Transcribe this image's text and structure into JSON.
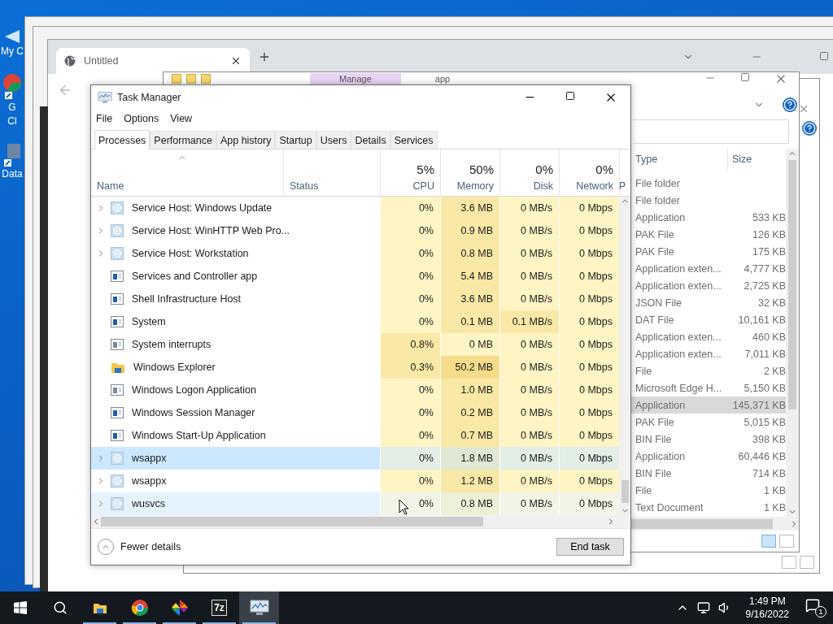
{
  "desktop_icons": [
    {
      "kind": "computer",
      "lines": [
        "My C"
      ]
    },
    {
      "kind": "chrome",
      "lines": [
        "G",
        "Cl"
      ]
    },
    {
      "kind": "drive",
      "lines": [
        "Data"
      ]
    }
  ],
  "browser": {
    "tab": "Untitled"
  },
  "explorer": {
    "ribbon_tabs": [
      {
        "label": "Manage",
        "highlighted": true
      },
      {
        "label": "app",
        "highlighted": false
      }
    ],
    "columns": [
      "Type",
      "Size"
    ],
    "rows": [
      {
        "type": "File folder",
        "size": "",
        "selected": false
      },
      {
        "type": "File folder",
        "size": "",
        "selected": false
      },
      {
        "type": "Application",
        "size": "533 KB",
        "selected": false
      },
      {
        "type": "PAK File",
        "size": "126 KB",
        "selected": false
      },
      {
        "type": "PAK File",
        "size": "175 KB",
        "selected": false
      },
      {
        "type": "Application exten...",
        "size": "4,777 KB",
        "selected": false
      },
      {
        "type": "Application exten...",
        "size": "2,725 KB",
        "selected": false
      },
      {
        "type": "JSON File",
        "size": "32 KB",
        "selected": false
      },
      {
        "type": "DAT File",
        "size": "10,161 KB",
        "selected": false
      },
      {
        "type": "Application exten...",
        "size": "460 KB",
        "selected": false
      },
      {
        "type": "Application exten...",
        "size": "7,011 KB",
        "selected": false
      },
      {
        "type": "File",
        "size": "2 KB",
        "selected": false
      },
      {
        "type": "Microsoft Edge H...",
        "size": "5,150 KB",
        "selected": false
      },
      {
        "type": "Application",
        "size": "145,371 KB",
        "selected": true
      },
      {
        "type": "PAK File",
        "size": "5,015 KB",
        "selected": false
      },
      {
        "type": "BIN File",
        "size": "398 KB",
        "selected": false
      },
      {
        "type": "Application",
        "size": "60,446 KB",
        "selected": false
      },
      {
        "type": "BIN File",
        "size": "714 KB",
        "selected": false
      },
      {
        "type": "File",
        "size": "1 KB",
        "selected": false
      },
      {
        "type": "Text Document",
        "size": "1 KB",
        "selected": false
      }
    ]
  },
  "task_manager": {
    "title": "Task Manager",
    "menu": [
      "File",
      "Options",
      "View"
    ],
    "tabs": [
      {
        "label": "Processes",
        "selected": true
      },
      {
        "label": "Performance",
        "selected": false
      },
      {
        "label": "App history",
        "selected": false
      },
      {
        "label": "Startup",
        "selected": false
      },
      {
        "label": "Users",
        "selected": false
      },
      {
        "label": "Details",
        "selected": false
      },
      {
        "label": "Services",
        "selected": false
      }
    ],
    "name_column": "Name",
    "status_column": "Status",
    "columns": [
      {
        "label": "CPU",
        "usage": "5%"
      },
      {
        "label": "Memory",
        "usage": "50%"
      },
      {
        "label": "Disk",
        "usage": "0%"
      },
      {
        "label": "Network",
        "usage": "0%"
      },
      {
        "label": "P"
      }
    ],
    "rows": [
      {
        "name": "Service Host: Windows Update",
        "kind": "service",
        "expandable": true,
        "selected": false,
        "hovered": false,
        "cells": [
          {
            "text": "0%",
            "color": "#fff4c4"
          },
          {
            "text": "3.6 MB",
            "color": "#f9e8a6"
          },
          {
            "text": "0 MB/s",
            "color": "#fff4c4"
          },
          {
            "text": "0 Mbps",
            "color": "#fff4c4"
          }
        ]
      },
      {
        "name": "Service Host: WinHTTP Web Pro...",
        "kind": "service",
        "expandable": true,
        "selected": false,
        "hovered": false,
        "cells": [
          {
            "text": "0%",
            "color": "#fff4c4"
          },
          {
            "text": "0.9 MB",
            "color": "#f9e8a6"
          },
          {
            "text": "0 MB/s",
            "color": "#fff4c4"
          },
          {
            "text": "0 Mbps",
            "color": "#fff4c4"
          }
        ]
      },
      {
        "name": "Service Host: Workstation",
        "kind": "service",
        "expandable": true,
        "selected": false,
        "hovered": false,
        "cells": [
          {
            "text": "0%",
            "color": "#fff4c4"
          },
          {
            "text": "0.8 MB",
            "color": "#f9e8a6"
          },
          {
            "text": "0 MB/s",
            "color": "#fff4c4"
          },
          {
            "text": "0 Mbps",
            "color": "#fff4c4"
          }
        ]
      },
      {
        "name": "Services and Controller app",
        "kind": "app",
        "expandable": false,
        "selected": false,
        "hovered": false,
        "cells": [
          {
            "text": "0%",
            "color": "#fff4c4"
          },
          {
            "text": "5.4 MB",
            "color": "#f9e8a6"
          },
          {
            "text": "0 MB/s",
            "color": "#fff4c4"
          },
          {
            "text": "0 Mbps",
            "color": "#fff4c4"
          }
        ]
      },
      {
        "name": "Shell Infrastructure Host",
        "kind": "app",
        "expandable": false,
        "selected": false,
        "hovered": false,
        "cells": [
          {
            "text": "0%",
            "color": "#fff4c4"
          },
          {
            "text": "3.6 MB",
            "color": "#f9e8a6"
          },
          {
            "text": "0 MB/s",
            "color": "#fff4c4"
          },
          {
            "text": "0 Mbps",
            "color": "#fff4c4"
          }
        ]
      },
      {
        "name": "System",
        "kind": "app",
        "expandable": false,
        "selected": false,
        "hovered": false,
        "cells": [
          {
            "text": "0%",
            "color": "#fff4c4"
          },
          {
            "text": "0.1 MB",
            "color": "#f9e8a6"
          },
          {
            "text": "0.1 MB/s",
            "color": "#f9e8a6"
          },
          {
            "text": "0 Mbps",
            "color": "#fff4c4"
          }
        ]
      },
      {
        "name": "System interrupts",
        "kind": "system",
        "expandable": false,
        "selected": false,
        "hovered": false,
        "cells": [
          {
            "text": "0.8%",
            "color": "#f9e8a6"
          },
          {
            "text": "0 MB",
            "color": "#fff4c4"
          },
          {
            "text": "0 MB/s",
            "color": "#fff4c4"
          },
          {
            "text": "0 Mbps",
            "color": "#fff4c4"
          }
        ]
      },
      {
        "name": "Windows Explorer",
        "kind": "explorer",
        "expandable": false,
        "selected": false,
        "hovered": false,
        "cells": [
          {
            "text": "0.3%",
            "color": "#f9e8a6"
          },
          {
            "text": "50.2 MB",
            "color": "#f6dc8a"
          },
          {
            "text": "0 MB/s",
            "color": "#fff4c4"
          },
          {
            "text": "0 Mbps",
            "color": "#fff4c4"
          }
        ]
      },
      {
        "name": "Windows Logon Application",
        "kind": "system",
        "expandable": false,
        "selected": false,
        "hovered": false,
        "cells": [
          {
            "text": "0%",
            "color": "#fff4c4"
          },
          {
            "text": "1.0 MB",
            "color": "#f9e8a6"
          },
          {
            "text": "0 MB/s",
            "color": "#fff4c4"
          },
          {
            "text": "0 Mbps",
            "color": "#fff4c4"
          }
        ]
      },
      {
        "name": "Windows Session Manager",
        "kind": "app",
        "expandable": false,
        "selected": false,
        "hovered": false,
        "cells": [
          {
            "text": "0%",
            "color": "#fff4c4"
          },
          {
            "text": "0.2 MB",
            "color": "#f9e8a6"
          },
          {
            "text": "0 MB/s",
            "color": "#fff4c4"
          },
          {
            "text": "0 Mbps",
            "color": "#fff4c4"
          }
        ]
      },
      {
        "name": "Windows Start-Up Application",
        "kind": "app",
        "expandable": false,
        "selected": false,
        "hovered": false,
        "cells": [
          {
            "text": "0%",
            "color": "#fff4c4"
          },
          {
            "text": "0.7 MB",
            "color": "#f9e8a6"
          },
          {
            "text": "0 MB/s",
            "color": "#fff4c4"
          },
          {
            "text": "0 Mbps",
            "color": "#fff4c4"
          }
        ]
      },
      {
        "name": "wsappx",
        "kind": "service",
        "expandable": true,
        "selected": true,
        "hovered": false,
        "cells": [
          {
            "text": "0%",
            "color": "#e2eee6"
          },
          {
            "text": "1.8 MB",
            "color": "#e0e7d2"
          },
          {
            "text": "0 MB/s",
            "color": "#e2eee6"
          },
          {
            "text": "0 Mbps",
            "color": "#e2eee6"
          }
        ]
      },
      {
        "name": "wsappx",
        "kind": "service",
        "expandable": true,
        "selected": false,
        "hovered": false,
        "cells": [
          {
            "text": "0%",
            "color": "#fff4c4"
          },
          {
            "text": "1.2 MB",
            "color": "#f9e8a6"
          },
          {
            "text": "0 MB/s",
            "color": "#fff4c4"
          },
          {
            "text": "0 Mbps",
            "color": "#fff4c4"
          }
        ]
      },
      {
        "name": "wusvcs",
        "kind": "service",
        "expandable": true,
        "selected": false,
        "hovered": true,
        "cells": [
          {
            "text": "0%",
            "color": "#f1f4e6"
          },
          {
            "text": "0.8 MB",
            "color": "#eff0d8"
          },
          {
            "text": "0 MB/s",
            "color": "#f1f4e6"
          },
          {
            "text": "0 Mbps",
            "color": "#f1f4e6"
          }
        ]
      }
    ],
    "footer": {
      "details": "Fewer details",
      "button": "End task"
    }
  },
  "taskbar": {
    "apps": [
      {
        "kind": "explorer",
        "active": false
      },
      {
        "kind": "chrome",
        "active": false
      },
      {
        "kind": "photos",
        "active": false
      },
      {
        "kind": "archiver",
        "label": "7z",
        "active": false
      },
      {
        "kind": "taskmanager",
        "active": true
      }
    ],
    "time": "1:49 PM",
    "date": "9/16/2022",
    "notifications": "1"
  }
}
